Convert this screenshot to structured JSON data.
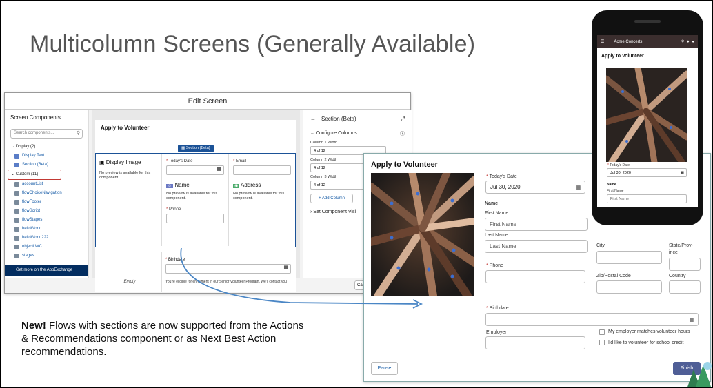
{
  "slide": {
    "title": "Multicolumn Screens (Generally Available)",
    "note_bold": "New!",
    "note_rest": " Flows with sections are now supported from the Actions & Recommendations component or as Next Best Action recommendations."
  },
  "editor": {
    "window_title": "Edit Screen",
    "left_heading": "Screen Components",
    "search_placeholder": "Search components...",
    "display_group": "Display (2)",
    "display_items": [
      "Display Text",
      "Section (Beta)"
    ],
    "custom_group": "Custom (11)",
    "custom_items": [
      "accountList",
      "flowChoiceNavigation",
      "flowFooter",
      "flowScript",
      "flowStages",
      "helloWorld",
      "helloWorld222",
      "objectLWC",
      "stages"
    ],
    "appexchange": "Get more on the AppExchange",
    "card_title": "Apply to Volunteer",
    "section_pill": "Section (Beta)",
    "col1_title": "Display Image",
    "col1_text": "No preview is available for this component.",
    "todays_date": "Today's Date",
    "email": "Email",
    "name": "Name",
    "address": "Address",
    "name_text": "No preview is available for this component.",
    "address_text": "No preview is available for this component.",
    "phone": "Phone",
    "empty": "Empty",
    "birthdate": "Birthdate",
    "eligible_text": "You're eligible for enrollment in our Senior Volunteer Program. We'll contact you",
    "cancel_btn": "Ca",
    "right_title": "Section (Beta)",
    "configure": "Configure Columns",
    "col_widths": [
      {
        "label": "Column 1 Width",
        "value": "4 of 12"
      },
      {
        "label": "Column 2 Width",
        "value": "4 of 12"
      },
      {
        "label": "Column 3 Width",
        "value": "4 of 12"
      }
    ],
    "add_column": "+ Add Column",
    "set_visibility": "Set Component Visi"
  },
  "form": {
    "title": "Apply to Volunteer",
    "todays_date_label": "Today's Date",
    "todays_date_value": "Jul 30, 2020",
    "name_label": "Name",
    "first_name_label": "First Name",
    "first_name_placeholder": "First Name",
    "last_name_label": "Last Name",
    "last_name_placeholder": "Last Name",
    "phone_label": "Phone",
    "city_label": "City",
    "state_label": "State/Prov-\nince",
    "zip_label": "Zip/Postal Code",
    "country_label": "Country",
    "birthdate_label": "Birthdate",
    "employer_label": "Employer",
    "cb1": "My employer matches volunteer hours",
    "cb2": "I'd like to volunteer for school credit",
    "pause": "Pause",
    "finish": "Finish"
  },
  "phone": {
    "brand": "Acme Concerts",
    "title": "Apply to Volunteer",
    "todays_date_label": "Today's Date",
    "date_value": "Jul 30, 2020",
    "name_label": "Name",
    "first_name_label": "First Name",
    "first_name_placeholder": "First Name"
  },
  "colors": {
    "accent": "#1b5297",
    "brand_dark": "#032d60",
    "finish": "#4f5e96",
    "required": "#c23934"
  }
}
